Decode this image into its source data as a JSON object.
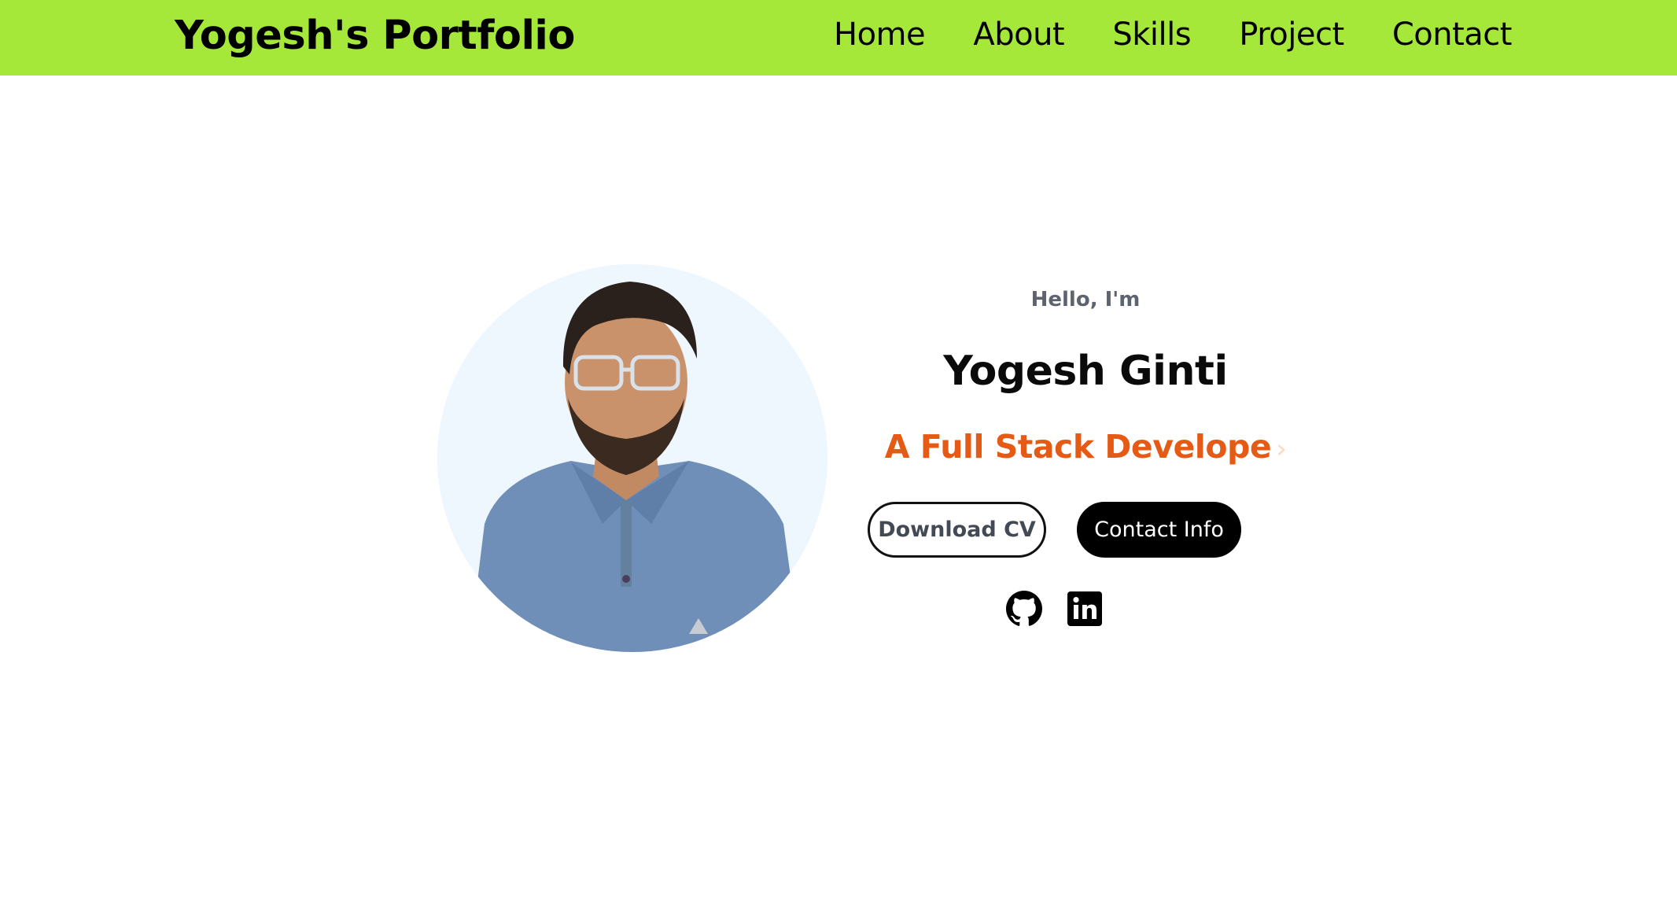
{
  "header": {
    "brand": "Yogesh's Portfolio",
    "nav": [
      "Home",
      "About",
      "Skills",
      "Project",
      "Contact"
    ],
    "background_color": "#a5e83a"
  },
  "hero": {
    "photo_icon": "profile-photo",
    "greeting": "Hello, I'm",
    "name": "Yogesh Ginti",
    "role": "A Full Stack Develope",
    "role_color": "#e55a14",
    "buttons": {
      "download": "Download CV",
      "contact": "Contact Info"
    },
    "social": [
      {
        "icon": "github-icon"
      },
      {
        "icon": "linkedin-icon"
      }
    ]
  }
}
